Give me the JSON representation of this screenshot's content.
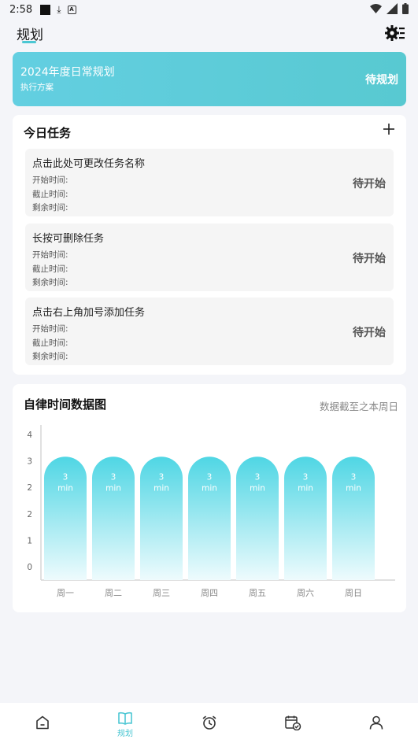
{
  "status_bar": {
    "time": "2:58"
  },
  "header": {
    "title": "规划"
  },
  "plan": {
    "title": "2024年度日常规划",
    "subtitle": "执行方案",
    "status": "待规划"
  },
  "tasks": {
    "title": "今日任务",
    "items": [
      {
        "name": "点击此处可更改任务名称",
        "start": "开始时间:",
        "end": "截止时间:",
        "remain": "剩余时间:",
        "status": "待开始"
      },
      {
        "name": "长按可删除任务",
        "start": "开始时间:",
        "end": "截止时间:",
        "remain": "剩余时间:",
        "status": "待开始"
      },
      {
        "name": "点击右上角加号添加任务",
        "start": "开始时间:",
        "end": "截止时间:",
        "remain": "剩余时间:",
        "status": "待开始"
      }
    ]
  },
  "chart_section": {
    "title": "自律时间数据图",
    "note": "数据截至之本周日"
  },
  "chart_data": {
    "type": "bar",
    "categories": [
      "周一",
      "周二",
      "周三",
      "周四",
      "周五",
      "周六",
      "周日"
    ],
    "values": [
      3,
      3,
      3,
      3,
      3,
      3,
      3
    ],
    "value_unit": "min",
    "y_tick_labels": [
      "0",
      "1",
      "2",
      "2",
      "3",
      "4"
    ],
    "ylim": [
      0,
      4
    ],
    "grid": false,
    "bar_color_top": "#4fd6e4",
    "bar_color_bottom": "#eefbfd"
  },
  "bottom_nav": {
    "active_label": "规划"
  },
  "colors": {
    "accent": "#4cc7d3",
    "banner": "#5ccbd8"
  }
}
